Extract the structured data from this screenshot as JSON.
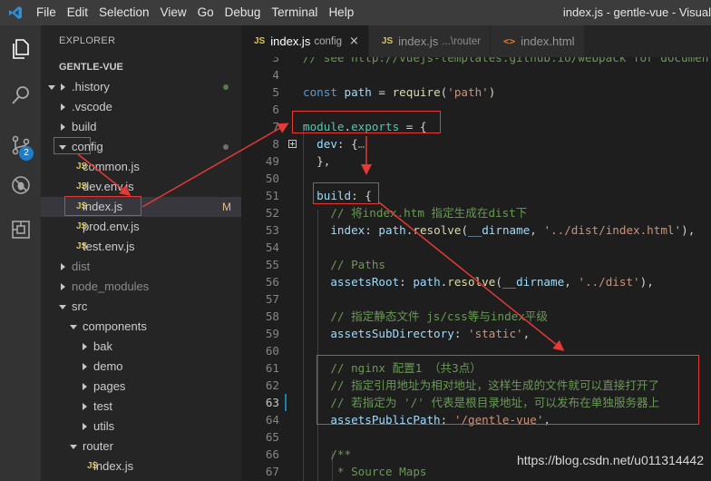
{
  "window": {
    "title": "index.js - gentle-vue - Visual"
  },
  "menu": [
    "File",
    "Edit",
    "Selection",
    "View",
    "Go",
    "Debug",
    "Terminal",
    "Help"
  ],
  "activity": {
    "icons": [
      "files-icon",
      "search-icon",
      "source-control-icon",
      "debug-icon",
      "extensions-icon"
    ],
    "scm_badge": "2",
    "accent_color": "#1c7ecc"
  },
  "explorer": {
    "title": "EXPLORER",
    "section": "GENTLE-VUE",
    "tree": [
      {
        "label": ".history",
        "type": "folder",
        "open": false,
        "depth": 0,
        "dot": "green"
      },
      {
        "label": ".vscode",
        "type": "folder",
        "open": false,
        "depth": 0
      },
      {
        "label": "build",
        "type": "folder",
        "open": false,
        "depth": 0
      },
      {
        "label": "config",
        "type": "folder",
        "open": true,
        "depth": 0,
        "dot": "gray"
      },
      {
        "label": "common.js",
        "type": "js",
        "depth": 1
      },
      {
        "label": "dev.env.js",
        "type": "js",
        "depth": 1
      },
      {
        "label": "index.js",
        "type": "js",
        "depth": 1,
        "selected": true,
        "git": "M"
      },
      {
        "label": "prod.env.js",
        "type": "js",
        "depth": 1
      },
      {
        "label": "test.env.js",
        "type": "js",
        "depth": 1
      },
      {
        "label": "dist",
        "type": "folder",
        "open": false,
        "depth": 0,
        "dim": true
      },
      {
        "label": "node_modules",
        "type": "folder",
        "open": false,
        "depth": 0,
        "dim": true
      },
      {
        "label": "src",
        "type": "folder",
        "open": true,
        "depth": 0
      },
      {
        "label": "components",
        "type": "folder",
        "open": true,
        "depth": 1
      },
      {
        "label": "bak",
        "type": "folder",
        "open": false,
        "depth": 2
      },
      {
        "label": "demo",
        "type": "folder",
        "open": false,
        "depth": 2
      },
      {
        "label": "pages",
        "type": "folder",
        "open": false,
        "depth": 2
      },
      {
        "label": "test",
        "type": "folder",
        "open": false,
        "depth": 2
      },
      {
        "label": "utils",
        "type": "folder",
        "open": false,
        "depth": 2
      },
      {
        "label": "router",
        "type": "folder",
        "open": true,
        "depth": 1
      },
      {
        "label": "index.js",
        "type": "js",
        "depth": 2
      }
    ]
  },
  "tabs": [
    {
      "icon": "JS",
      "label": "index.js",
      "desc": "config",
      "active": true,
      "close": "×"
    },
    {
      "icon": "JS",
      "label": "index.js",
      "desc": "...\\router",
      "active": false
    },
    {
      "icon": "<>",
      "label": "index.html",
      "desc": "",
      "active": false
    }
  ],
  "editor": {
    "lines": [
      {
        "n": "3",
        "tokens": [
          [
            "// see http://vuejs-templates.github.io/webpack for documentation.",
            "#6a9955"
          ]
        ]
      },
      {
        "n": "4",
        "tokens": []
      },
      {
        "n": "5",
        "tokens": [
          [
            "const ",
            "#569cd6"
          ],
          [
            "path",
            "#9cdcfe"
          ],
          [
            " = ",
            "#d4d4d4"
          ],
          [
            "require",
            "#dcdcaa"
          ],
          [
            "(",
            "#d4d4d4"
          ],
          [
            "'path'",
            "#ce9178"
          ],
          [
            ")",
            "#d4d4d4"
          ]
        ]
      },
      {
        "n": "6",
        "tokens": []
      },
      {
        "n": "7",
        "tokens": [
          [
            "module",
            "#4ec9b0"
          ],
          [
            ".",
            "#d4d4d4"
          ],
          [
            "exports",
            "#4ec9b0"
          ],
          [
            " = {",
            "#d4d4d4"
          ]
        ]
      },
      {
        "n": "8",
        "tokens": [
          [
            "  dev",
            "#9cdcfe"
          ],
          [
            ": {",
            "#d4d4d4"
          ],
          [
            "…",
            "#808080"
          ]
        ],
        "fold": true
      },
      {
        "n": "49",
        "tokens": [
          [
            "  },",
            "#d4d4d4"
          ]
        ]
      },
      {
        "n": "50",
        "tokens": []
      },
      {
        "n": "51",
        "tokens": [
          [
            "  build",
            "#9cdcfe"
          ],
          [
            ": {",
            "#d4d4d4"
          ]
        ]
      },
      {
        "n": "52",
        "tokens": [
          [
            "    // 将index.htm 指定生成在dist下",
            "#6a9955"
          ]
        ]
      },
      {
        "n": "53",
        "tokens": [
          [
            "    index",
            "#9cdcfe"
          ],
          [
            ": ",
            "#d4d4d4"
          ],
          [
            "path",
            "#9cdcfe"
          ],
          [
            ".",
            "#d4d4d4"
          ],
          [
            "resolve",
            "#dcdcaa"
          ],
          [
            "(",
            "#d4d4d4"
          ],
          [
            "__dirname",
            "#9cdcfe"
          ],
          [
            ", ",
            "#d4d4d4"
          ],
          [
            "'../dist/index.html'",
            "#ce9178"
          ],
          [
            "),",
            "#d4d4d4"
          ]
        ]
      },
      {
        "n": "54",
        "tokens": []
      },
      {
        "n": "55",
        "tokens": [
          [
            "    // Paths",
            "#6a9955"
          ]
        ]
      },
      {
        "n": "56",
        "tokens": [
          [
            "    assetsRoot",
            "#9cdcfe"
          ],
          [
            ": ",
            "#d4d4d4"
          ],
          [
            "path",
            "#9cdcfe"
          ],
          [
            ".",
            "#d4d4d4"
          ],
          [
            "resolve",
            "#dcdcaa"
          ],
          [
            "(",
            "#d4d4d4"
          ],
          [
            "__dirname",
            "#9cdcfe"
          ],
          [
            ", ",
            "#d4d4d4"
          ],
          [
            "'../dist'",
            "#ce9178"
          ],
          [
            "),",
            "#d4d4d4"
          ]
        ]
      },
      {
        "n": "57",
        "tokens": []
      },
      {
        "n": "58",
        "tokens": [
          [
            "    // 指定静态文件 js/css等与index平级",
            "#6a9955"
          ]
        ]
      },
      {
        "n": "59",
        "tokens": [
          [
            "    assetsSubDirectory",
            "#9cdcfe"
          ],
          [
            ": ",
            "#d4d4d4"
          ],
          [
            "'static'",
            "#ce9178"
          ],
          [
            ",",
            "#d4d4d4"
          ]
        ]
      },
      {
        "n": "60",
        "tokens": []
      },
      {
        "n": "61",
        "tokens": [
          [
            "    // nginx 配置1 （共3点）",
            "#6a9955"
          ]
        ]
      },
      {
        "n": "62",
        "tokens": [
          [
            "    // 指定引用地址为相对地址，这样生成的文件就可以直接打开了",
            "#6a9955"
          ]
        ]
      },
      {
        "n": "63",
        "tokens": [
          [
            "    // 若指定为 '/' 代表是根目录地址，可以发布在单独服务器上",
            "#6a9955"
          ]
        ],
        "active": true,
        "modified": true
      },
      {
        "n": "64",
        "tokens": [
          [
            "    assetsPublicPath",
            "#9cdcfe"
          ],
          [
            ": ",
            "#d4d4d4"
          ],
          [
            "'/gentle-vue'",
            "#ce9178"
          ],
          [
            ",",
            "#d4d4d4"
          ]
        ]
      },
      {
        "n": "65",
        "tokens": []
      },
      {
        "n": "66",
        "tokens": [
          [
            "    /**",
            "#6a9955"
          ]
        ]
      },
      {
        "n": "67",
        "tokens": [
          [
            "     * Source Maps",
            "#6a9955"
          ]
        ]
      }
    ]
  },
  "annotation_color": "#e53935",
  "watermark": "https://blog.csdn.net/u011314442"
}
